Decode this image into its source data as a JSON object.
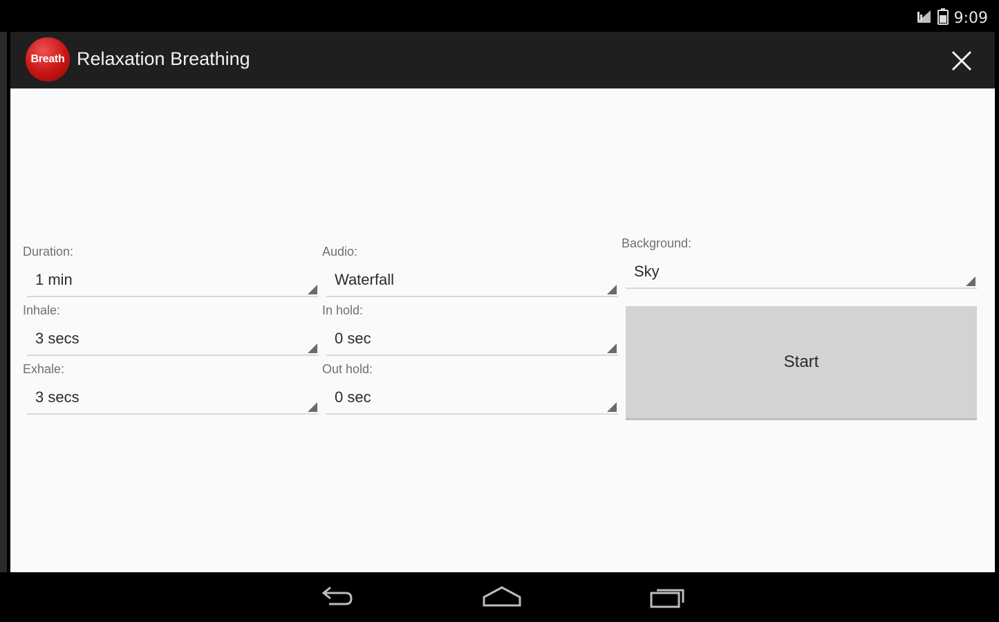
{
  "status_bar": {
    "time": "9:09",
    "icons": [
      "signal-icon",
      "battery-icon"
    ]
  },
  "action_bar": {
    "logo_text": "Breath",
    "title": "Relaxation Breathing",
    "close_icon": "close-icon"
  },
  "form": {
    "duration": {
      "label": "Duration:",
      "value": "1 min"
    },
    "audio": {
      "label": "Audio:",
      "value": "Waterfall"
    },
    "background": {
      "label": "Background:",
      "value": "Sky"
    },
    "inhale": {
      "label": "Inhale:",
      "value": "3 secs"
    },
    "in_hold": {
      "label": "In hold:",
      "value": "0 sec"
    },
    "exhale": {
      "label": "Exhale:",
      "value": "3 secs"
    },
    "out_hold": {
      "label": "Out hold:",
      "value": "0 sec"
    },
    "start_label": "Start"
  },
  "nav_bar": {
    "icons": [
      "back-icon",
      "home-icon",
      "recent-apps-icon"
    ]
  },
  "colors": {
    "accent_red": "#c81414",
    "action_bar": "#1f1f1f",
    "content_bg": "#fafafa",
    "button_bg": "#d3d3d3"
  }
}
